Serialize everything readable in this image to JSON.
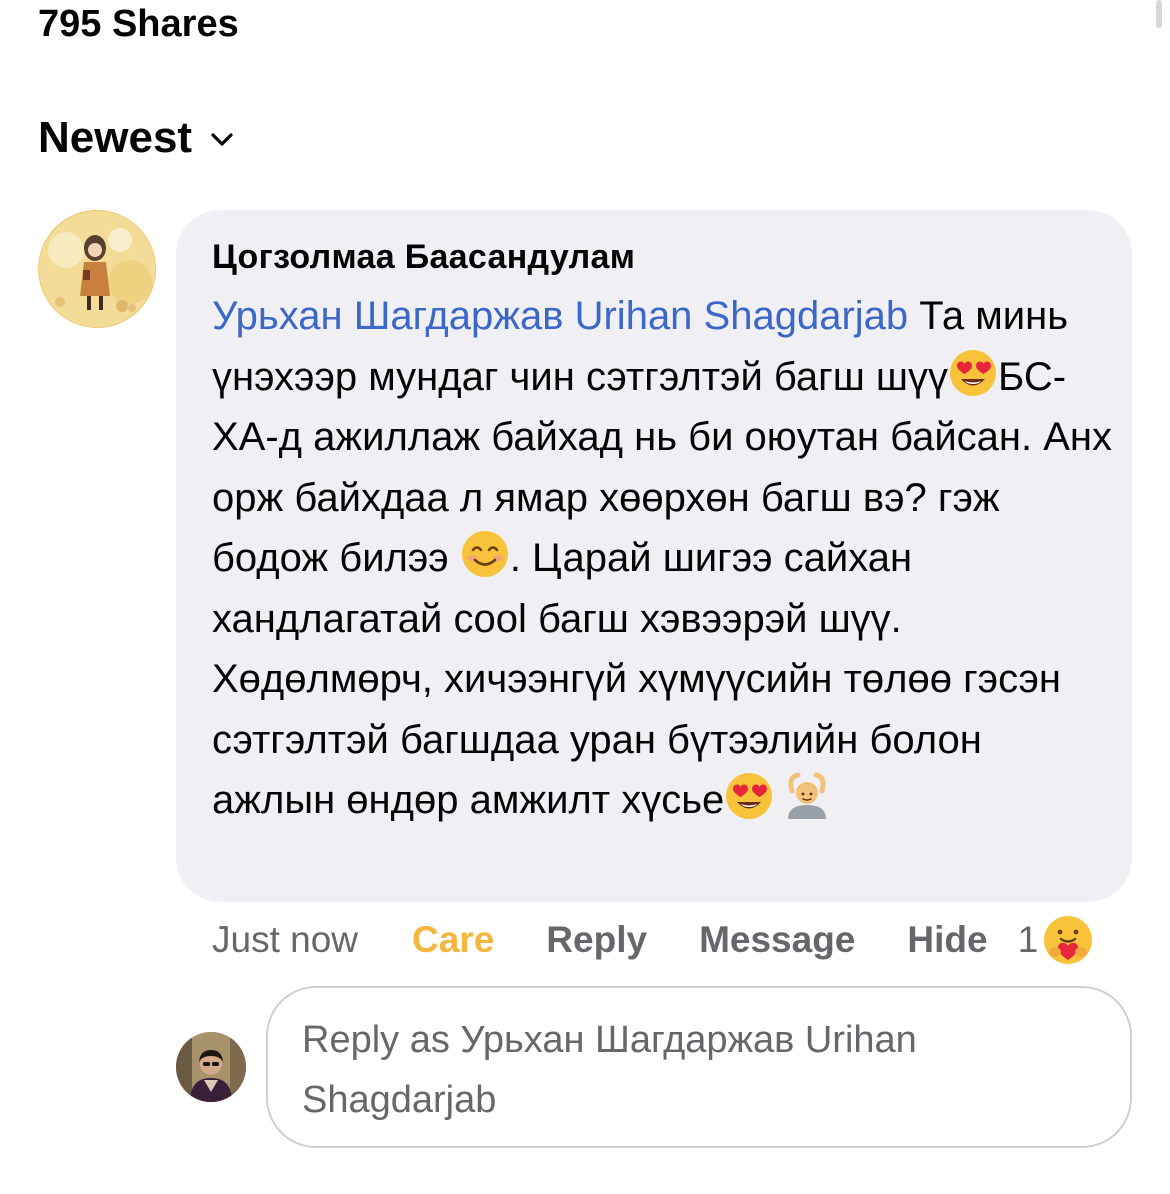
{
  "header": {
    "shares_text": "795 Shares",
    "sort_label": "Newest"
  },
  "comment": {
    "author": "Цогзолмаа Баасандулам",
    "mention": "Урьхан Шагдаржав Urihan Shagdarjab",
    "segments": [
      " Та минь үнэхээр мундаг чин сэтгэлтэй багш шүү",
      "БС-ХА-д ажиллаж байхад нь би оюутан байсан. Анх орж байхдаа л ямар хөөрхөн багш вэ? гэж бодож билээ ",
      ". Царай шигээ сайхан хандлагатай cool багш хэвээрэй шүү. Хөдөлмөрч, хичээнгүй хүмүүсийн төлөө гэсэн сэтгэлтэй багшдаа уран бүтээлийн болон ажлын өндөр амжилт хүсье"
    ],
    "emojis": [
      "heart-eyes",
      "smiling-face",
      "heart-eyes",
      "person-gesturing-ok"
    ]
  },
  "actions": {
    "time": "Just now",
    "care": "Care",
    "reply": "Reply",
    "message": "Message",
    "hide": "Hide",
    "reaction_count": "1",
    "reaction_emoji": "care-hug"
  },
  "reply_box": {
    "placeholder": "Reply as Урьхан Шагдаржав Urihan Shagdarjab"
  },
  "colors": {
    "mention": "#3b67c9",
    "care": "#f4b63e",
    "bubble": "#f0f0f4",
    "muted": "#65676b"
  }
}
